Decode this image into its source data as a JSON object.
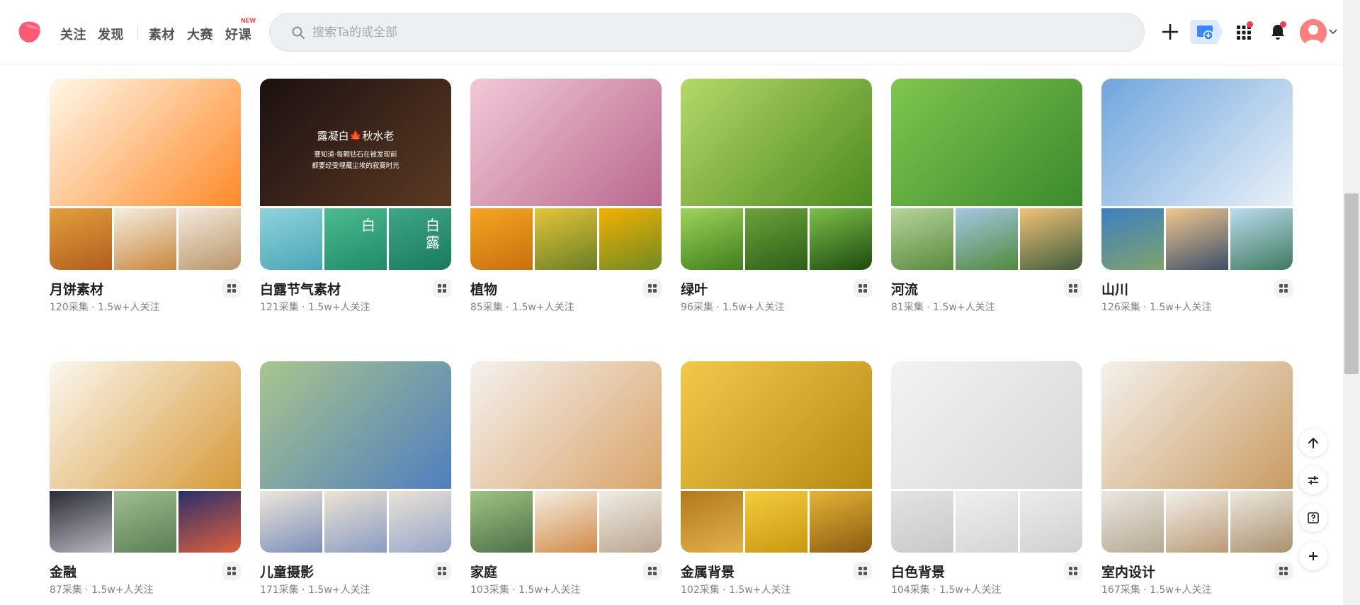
{
  "header": {
    "nav": [
      {
        "label": "关注"
      },
      {
        "label": "发现"
      },
      {
        "label": "素材"
      },
      {
        "label": "大赛"
      },
      {
        "label": "好课"
      }
    ],
    "new_badge": "NEW",
    "search_placeholder": "搜索Ta的或全部",
    "search_value": ""
  },
  "colors": {
    "brand": "#ff5a76",
    "accent_blue": "#3a86ff",
    "notification": "#ff3b54"
  },
  "cards": [
    {
      "title": "月饼素材",
      "meta": "120采集 · 1.5w+人关注",
      "main": [
        "#fff8ea",
        "#ff8a2a"
      ],
      "subs": [
        [
          "#e2a03b",
          "#b25d1f"
        ],
        [
          "#f5eee0",
          "#c9863d"
        ],
        [
          "#f4eadb",
          "#b8956a"
        ]
      ]
    },
    {
      "title": "白露节气素材",
      "meta": "121采集 · 1.5w+人关注",
      "main_text": [
        "露凝白🍁秋水老",
        "要知道·每颗钻石在被发现前",
        "都要经受埋藏尘埃的寂寞时光"
      ],
      "sub_texts": [
        "白",
        "白露"
      ],
      "main": [
        "#1b1010",
        "#5b3a23"
      ],
      "subs": [
        [
          "#8ed3dc",
          "#4ba6b7"
        ],
        [
          "#4dbb8f",
          "#1f8b6a"
        ],
        [
          "#3ea784",
          "#1a7a5e"
        ]
      ]
    },
    {
      "title": "植物",
      "meta": "85采集 · 1.5w+人关注",
      "main": [
        "#f2c9d8",
        "#b9688d"
      ],
      "subs": [
        [
          "#f5a623",
          "#c86f0e"
        ],
        [
          "#e6c43a",
          "#6a7f25"
        ],
        [
          "#f4b000",
          "#6f8a24"
        ]
      ]
    },
    {
      "title": "绿叶",
      "meta": "96采集 · 1.5w+人关注",
      "main": [
        "#b5d86a",
        "#4c8a1f"
      ],
      "subs": [
        [
          "#9fd35b",
          "#3f7f1c"
        ],
        [
          "#6ca33b",
          "#2d5f17"
        ],
        [
          "#7cc04a",
          "#1c4a0e"
        ]
      ]
    },
    {
      "title": "河流",
      "meta": "81采集 · 1.5w+人关注",
      "main": [
        "#7fc64f",
        "#3c8a2c"
      ],
      "subs": [
        [
          "#b6d49c",
          "#5a8a3e"
        ],
        [
          "#a3c8e6",
          "#4f8a3a"
        ],
        [
          "#f1c27a",
          "#3e5c3a"
        ]
      ]
    },
    {
      "title": "山川",
      "meta": "126采集 · 1.5w+人关注",
      "main": [
        "#6fa6dc",
        "#eaf1f8"
      ],
      "subs": [
        [
          "#3d7fc4",
          "#7ea36a"
        ],
        [
          "#f1c88e",
          "#3d4f6b"
        ],
        [
          "#b9dcee",
          "#3e7a5e"
        ]
      ]
    },
    {
      "title": "金融",
      "meta": "87采集 · 1.5w+人关注",
      "main": [
        "#fbf7ef",
        "#d79a3a"
      ],
      "subs": [
        [
          "#2a2b35",
          "#b7b7bf"
        ],
        [
          "#9fbe8f",
          "#5b7e55"
        ],
        [
          "#2a2f6b",
          "#e0603c"
        ]
      ]
    },
    {
      "title": "儿童摄影",
      "meta": "171采集 · 1.5w+人关注",
      "main": [
        "#a9c58d",
        "#4f7fc0"
      ],
      "subs": [
        [
          "#eee6dc",
          "#7b8fb8"
        ],
        [
          "#ece3d4",
          "#8a9cc2"
        ],
        [
          "#eae2d6",
          "#96a6c8"
        ]
      ]
    },
    {
      "title": "家庭",
      "meta": "103采集 · 1.5w+人关注",
      "main": [
        "#f4f2ef",
        "#d9a46a"
      ],
      "subs": [
        [
          "#9fc481",
          "#4f6f49"
        ],
        [
          "#f5ede3",
          "#d18b46"
        ],
        [
          "#f2ece4",
          "#b7a58e"
        ]
      ]
    },
    {
      "title": "金属背景",
      "meta": "102采集 · 1.5w+人关注",
      "main": [
        "#f2c94c",
        "#b58a12"
      ],
      "subs": [
        [
          "#b3781c",
          "#e1b24a"
        ],
        [
          "#f4cc3c",
          "#c99712"
        ],
        [
          "#e5b436",
          "#8a5b12"
        ]
      ]
    },
    {
      "title": "白色背景",
      "meta": "104采集 · 1.5w+人关注",
      "main": [
        "#f3f3f3",
        "#d7d7d7"
      ],
      "subs": [
        [
          "#e3e3e3",
          "#c8c8c8"
        ],
        [
          "#efefef",
          "#d4d4d4"
        ],
        [
          "#ececec",
          "#cfcfcf"
        ]
      ]
    },
    {
      "title": "室内设计",
      "meta": "167采集 · 1.5w+人关注",
      "main": [
        "#f4f1ec",
        "#c99b62"
      ],
      "subs": [
        [
          "#eae7e1",
          "#b7a992"
        ],
        [
          "#f2efe8",
          "#b99b76"
        ],
        [
          "#ede8df",
          "#a8906d"
        ]
      ]
    }
  ]
}
